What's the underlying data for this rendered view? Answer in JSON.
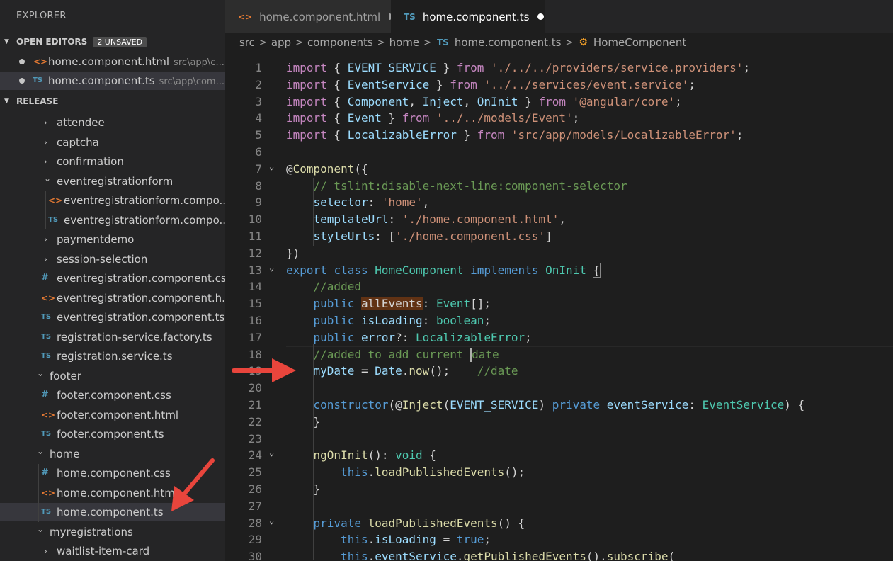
{
  "sidebar": {
    "title": "EXPLORER",
    "open_editors": {
      "label": "OPEN EDITORS",
      "badge": "2 UNSAVED",
      "items": [
        {
          "icon": "html",
          "name": "home.component.html",
          "path": "src\\app\\c..."
        },
        {
          "icon": "ts",
          "name": "home.component.ts",
          "path": "src\\app\\com..."
        }
      ]
    },
    "release": {
      "label": "RELEASE",
      "items": [
        {
          "kind": "folder",
          "name": "attendee"
        },
        {
          "kind": "folder",
          "name": "captcha"
        },
        {
          "kind": "folder",
          "name": "confirmation"
        },
        {
          "kind": "folder-open",
          "name": "eventregistrationform"
        },
        {
          "kind": "html",
          "name": "eventregistrationform.compo..."
        },
        {
          "kind": "ts",
          "name": "eventregistrationform.compo..."
        },
        {
          "kind": "folder",
          "name": "paymentdemo"
        },
        {
          "kind": "folder",
          "name": "session-selection"
        },
        {
          "kind": "css",
          "name": "eventregistration.component.css"
        },
        {
          "kind": "html",
          "name": "eventregistration.component.h..."
        },
        {
          "kind": "ts",
          "name": "eventregistration.component.ts"
        },
        {
          "kind": "ts",
          "name": "registration-service.factory.ts"
        },
        {
          "kind": "ts",
          "name": "registration.service.ts"
        },
        {
          "kind": "folder-open",
          "name": "footer"
        },
        {
          "kind": "css",
          "name": "footer.component.css"
        },
        {
          "kind": "html",
          "name": "footer.component.html"
        },
        {
          "kind": "ts",
          "name": "footer.component.ts"
        },
        {
          "kind": "folder-open",
          "name": "home"
        },
        {
          "kind": "css",
          "name": "home.component.css"
        },
        {
          "kind": "html",
          "name": "home.component.html"
        },
        {
          "kind": "ts",
          "name": "home.component.ts"
        },
        {
          "kind": "folder-open",
          "name": "myregistrations"
        },
        {
          "kind": "folder",
          "name": "waitlist-item-card"
        }
      ]
    }
  },
  "icons": {
    "ts": "TS",
    "html": "<>",
    "css": "#",
    "folder": "›",
    "folder_open": "⌄"
  },
  "tabs": [
    {
      "label": "home.component.html",
      "icon": "<>",
      "unsaved": true
    },
    {
      "label": "home.component.ts",
      "icon": "TS",
      "unsaved": true,
      "active": true
    }
  ],
  "breadcrumb": [
    "src",
    "app",
    "components",
    "home",
    "home.component.ts",
    "HomeComponent"
  ],
  "code": [
    {
      "n": "1",
      "t": [
        [
          "import",
          "import"
        ],
        [
          " { ",
          "plain"
        ],
        [
          "EVENT_SERVICE",
          "var"
        ],
        [
          " } ",
          "plain"
        ],
        [
          "from",
          "import"
        ],
        [
          " ",
          "plain"
        ],
        [
          "'./../../providers/service.providers'",
          "string"
        ],
        [
          ";",
          "plain"
        ]
      ]
    },
    {
      "n": "2",
      "t": [
        [
          "import",
          "import"
        ],
        [
          " { ",
          "plain"
        ],
        [
          "EventService",
          "var"
        ],
        [
          " } ",
          "plain"
        ],
        [
          "from",
          "import"
        ],
        [
          " ",
          "plain"
        ],
        [
          "'../../services/event.service'",
          "string"
        ],
        [
          ";",
          "plain"
        ]
      ]
    },
    {
      "n": "3",
      "t": [
        [
          "import",
          "import"
        ],
        [
          " { ",
          "plain"
        ],
        [
          "Component",
          "var"
        ],
        [
          ", ",
          "plain"
        ],
        [
          "Inject",
          "var"
        ],
        [
          ", ",
          "plain"
        ],
        [
          "OnInit",
          "var"
        ],
        [
          " } ",
          "plain"
        ],
        [
          "from",
          "import"
        ],
        [
          " ",
          "plain"
        ],
        [
          "'@angular/core'",
          "string"
        ],
        [
          ";",
          "plain"
        ]
      ]
    },
    {
      "n": "4",
      "t": [
        [
          "import",
          "import"
        ],
        [
          " { ",
          "plain"
        ],
        [
          "Event",
          "var"
        ],
        [
          " } ",
          "plain"
        ],
        [
          "from",
          "import"
        ],
        [
          " ",
          "plain"
        ],
        [
          "'../../models/Event'",
          "string"
        ],
        [
          ";",
          "plain"
        ]
      ]
    },
    {
      "n": "5",
      "t": [
        [
          "import",
          "import"
        ],
        [
          " { ",
          "plain"
        ],
        [
          "LocalizableError",
          "var"
        ],
        [
          " } ",
          "plain"
        ],
        [
          "from",
          "import"
        ],
        [
          " ",
          "plain"
        ],
        [
          "'src/app/models/LocalizableError'",
          "string"
        ],
        [
          ";",
          "plain"
        ]
      ]
    },
    {
      "n": "6",
      "t": []
    },
    {
      "n": "7",
      "fold": true,
      "t": [
        [
          "@",
          "plain"
        ],
        [
          "Component",
          "func"
        ],
        [
          "({",
          "plain"
        ]
      ]
    },
    {
      "n": "8",
      "t": [
        [
          "    ",
          "plain"
        ],
        [
          "// tslint:disable-next-line:component-selector",
          "comment"
        ]
      ]
    },
    {
      "n": "9",
      "t": [
        [
          "    ",
          "plain"
        ],
        [
          "selector",
          "var"
        ],
        [
          ": ",
          "plain"
        ],
        [
          "'home'",
          "string"
        ],
        [
          ",",
          "plain"
        ]
      ]
    },
    {
      "n": "10",
      "t": [
        [
          "    ",
          "plain"
        ],
        [
          "templateUrl",
          "var"
        ],
        [
          ": ",
          "plain"
        ],
        [
          "'./home.component.html'",
          "string"
        ],
        [
          ",",
          "plain"
        ]
      ]
    },
    {
      "n": "11",
      "t": [
        [
          "    ",
          "plain"
        ],
        [
          "styleUrls",
          "var"
        ],
        [
          ": [",
          "plain"
        ],
        [
          "'./home.component.css'",
          "string"
        ],
        [
          "]",
          "plain"
        ]
      ]
    },
    {
      "n": "12",
      "t": [
        [
          "})",
          "plain"
        ]
      ]
    },
    {
      "n": "13",
      "fold": true,
      "t": [
        [
          "export",
          "keyword"
        ],
        [
          " ",
          "plain"
        ],
        [
          "class",
          "keyword"
        ],
        [
          " ",
          "plain"
        ],
        [
          "HomeComponent",
          "type"
        ],
        [
          " ",
          "plain"
        ],
        [
          "implements",
          "keyword"
        ],
        [
          " ",
          "plain"
        ],
        [
          "OnInit",
          "type"
        ],
        [
          " ",
          "plain"
        ],
        [
          "{",
          "bracket"
        ]
      ]
    },
    {
      "n": "14",
      "t": [
        [
          "    ",
          "plain"
        ],
        [
          "//added",
          "comment"
        ]
      ]
    },
    {
      "n": "15",
      "t": [
        [
          "    ",
          "plain"
        ],
        [
          "public",
          "keyword"
        ],
        [
          " ",
          "plain"
        ],
        [
          "allEvents",
          "hl"
        ],
        [
          ": ",
          "plain"
        ],
        [
          "Event",
          "type"
        ],
        [
          "[];",
          "plain"
        ]
      ]
    },
    {
      "n": "16",
      "t": [
        [
          "    ",
          "plain"
        ],
        [
          "public",
          "keyword"
        ],
        [
          " ",
          "plain"
        ],
        [
          "isLoading",
          "var"
        ],
        [
          ": ",
          "plain"
        ],
        [
          "boolean",
          "type"
        ],
        [
          ";",
          "plain"
        ]
      ]
    },
    {
      "n": "17",
      "t": [
        [
          "    ",
          "plain"
        ],
        [
          "public",
          "keyword"
        ],
        [
          " ",
          "plain"
        ],
        [
          "error",
          "var"
        ],
        [
          "?: ",
          "plain"
        ],
        [
          "LocalizableError",
          "type"
        ],
        [
          ";",
          "plain"
        ]
      ]
    },
    {
      "n": "18",
      "current": true,
      "t": [
        [
          "    ",
          "plain"
        ],
        [
          "//added to add current ",
          "comment"
        ],
        [
          "",
          "caret"
        ],
        [
          "date",
          "comment"
        ]
      ]
    },
    {
      "n": "19",
      "t": [
        [
          "    ",
          "plain"
        ],
        [
          "myDate",
          "var"
        ],
        [
          " = ",
          "plain"
        ],
        [
          "Date",
          "var"
        ],
        [
          ".",
          "plain"
        ],
        [
          "now",
          "func"
        ],
        [
          "();    ",
          "plain"
        ],
        [
          "//date",
          "comment"
        ]
      ]
    },
    {
      "n": "20",
      "t": []
    },
    {
      "n": "21",
      "t": [
        [
          "    ",
          "plain"
        ],
        [
          "constructor",
          "keyword"
        ],
        [
          "(@",
          "plain"
        ],
        [
          "Inject",
          "func"
        ],
        [
          "(",
          "plain"
        ],
        [
          "EVENT_SERVICE",
          "var"
        ],
        [
          ") ",
          "plain"
        ],
        [
          "private",
          "keyword"
        ],
        [
          " ",
          "plain"
        ],
        [
          "eventService",
          "var"
        ],
        [
          ": ",
          "plain"
        ],
        [
          "EventService",
          "type"
        ],
        [
          ") {",
          "plain"
        ]
      ]
    },
    {
      "n": "22",
      "t": [
        [
          "    }",
          "plain"
        ]
      ]
    },
    {
      "n": "23",
      "t": []
    },
    {
      "n": "24",
      "fold": true,
      "t": [
        [
          "    ",
          "plain"
        ],
        [
          "ngOnInit",
          "func"
        ],
        [
          "(): ",
          "plain"
        ],
        [
          "void",
          "type"
        ],
        [
          " {",
          "plain"
        ]
      ]
    },
    {
      "n": "25",
      "t": [
        [
          "        ",
          "plain"
        ],
        [
          "this",
          "keyword"
        ],
        [
          ".",
          "plain"
        ],
        [
          "loadPublishedEvents",
          "func"
        ],
        [
          "();",
          "plain"
        ]
      ]
    },
    {
      "n": "26",
      "t": [
        [
          "    }",
          "plain"
        ]
      ]
    },
    {
      "n": "27",
      "t": []
    },
    {
      "n": "28",
      "fold": true,
      "t": [
        [
          "    ",
          "plain"
        ],
        [
          "private",
          "keyword"
        ],
        [
          " ",
          "plain"
        ],
        [
          "loadPublishedEvents",
          "func"
        ],
        [
          "() {",
          "plain"
        ]
      ]
    },
    {
      "n": "29",
      "t": [
        [
          "        ",
          "plain"
        ],
        [
          "this",
          "keyword"
        ],
        [
          ".",
          "plain"
        ],
        [
          "isLoading",
          "var"
        ],
        [
          " = ",
          "plain"
        ],
        [
          "true",
          "keyword"
        ],
        [
          ";",
          "plain"
        ]
      ]
    },
    {
      "n": "30",
      "t": [
        [
          "        ",
          "plain"
        ],
        [
          "this",
          "keyword"
        ],
        [
          ".",
          "plain"
        ],
        [
          "eventService",
          "var"
        ],
        [
          ".",
          "plain"
        ],
        [
          "getPublishedEvents",
          "func"
        ],
        [
          "().",
          "plain"
        ],
        [
          "subscribe",
          "func"
        ],
        [
          "(",
          "plain"
        ]
      ]
    }
  ],
  "colors": {
    "accent": "#519aba",
    "arrow": "#e8453c"
  }
}
